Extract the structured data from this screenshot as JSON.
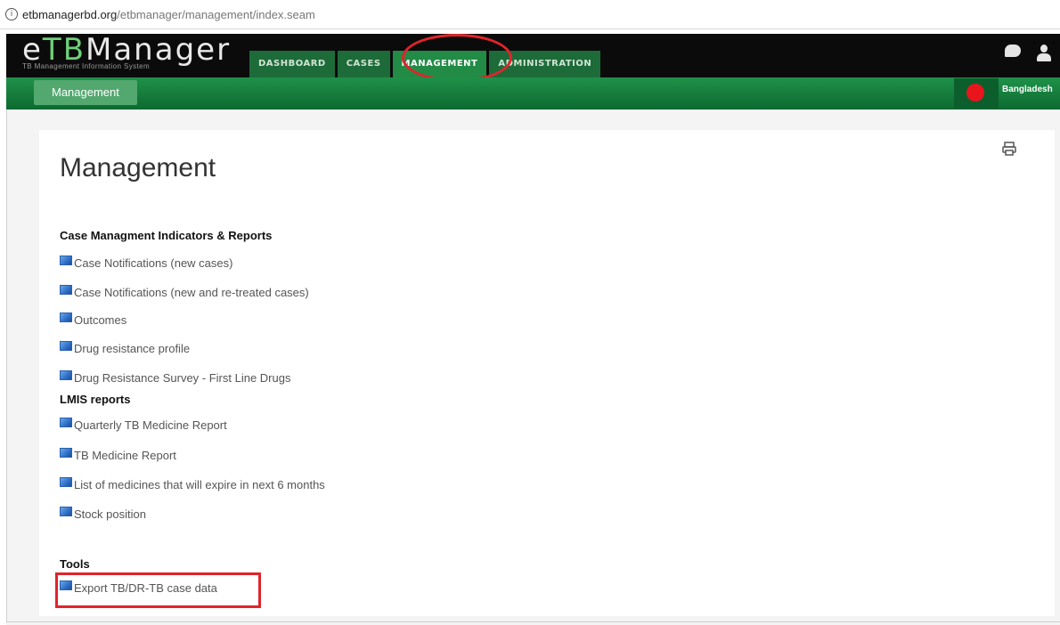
{
  "browser": {
    "url_domain": "etbmanagerbd.org",
    "url_path": "/etbmanager/management/index.seam"
  },
  "app": {
    "logo_prefix": "e",
    "logo_tb": "TB",
    "logo_suffix": "Manager",
    "logo_subtitle": "TB Management Information System",
    "nav_tabs": [
      {
        "label": "DASHBOARD"
      },
      {
        "label": "CASES"
      },
      {
        "label": "MANAGEMENT"
      },
      {
        "label": "ADMINISTRATION"
      }
    ],
    "active_tab": "MANAGEMENT",
    "icons": [
      "chat-icon",
      "user-icon",
      "print-icon",
      "report-icon",
      "info-icon"
    ],
    "colors": {
      "header_bg": "#0b0b0b",
      "nav_tab": "#1e6b3a",
      "subbar": "#1f9149",
      "highlight": "#e0242b",
      "flag_red": "#e8161c"
    }
  },
  "subbar": {
    "button_label": "Management",
    "country": "Bangladesh"
  },
  "main": {
    "title": "Management",
    "sections": [
      {
        "title": "Case Managment Indicators & Reports",
        "items": [
          "Case Notifications (new cases)",
          "Case Notifications (new and re-treated cases)",
          "Outcomes",
          "Drug resistance profile",
          "Drug Resistance Survey - First Line Drugs"
        ]
      },
      {
        "title": "LMIS reports",
        "items": [
          "Quarterly TB Medicine Report",
          "TB Medicine Report",
          "List of medicines that will expire in next 6 months",
          "Stock position"
        ]
      },
      {
        "title": "Tools",
        "items": [
          "Export TB/DR-TB case data"
        ]
      }
    ]
  }
}
